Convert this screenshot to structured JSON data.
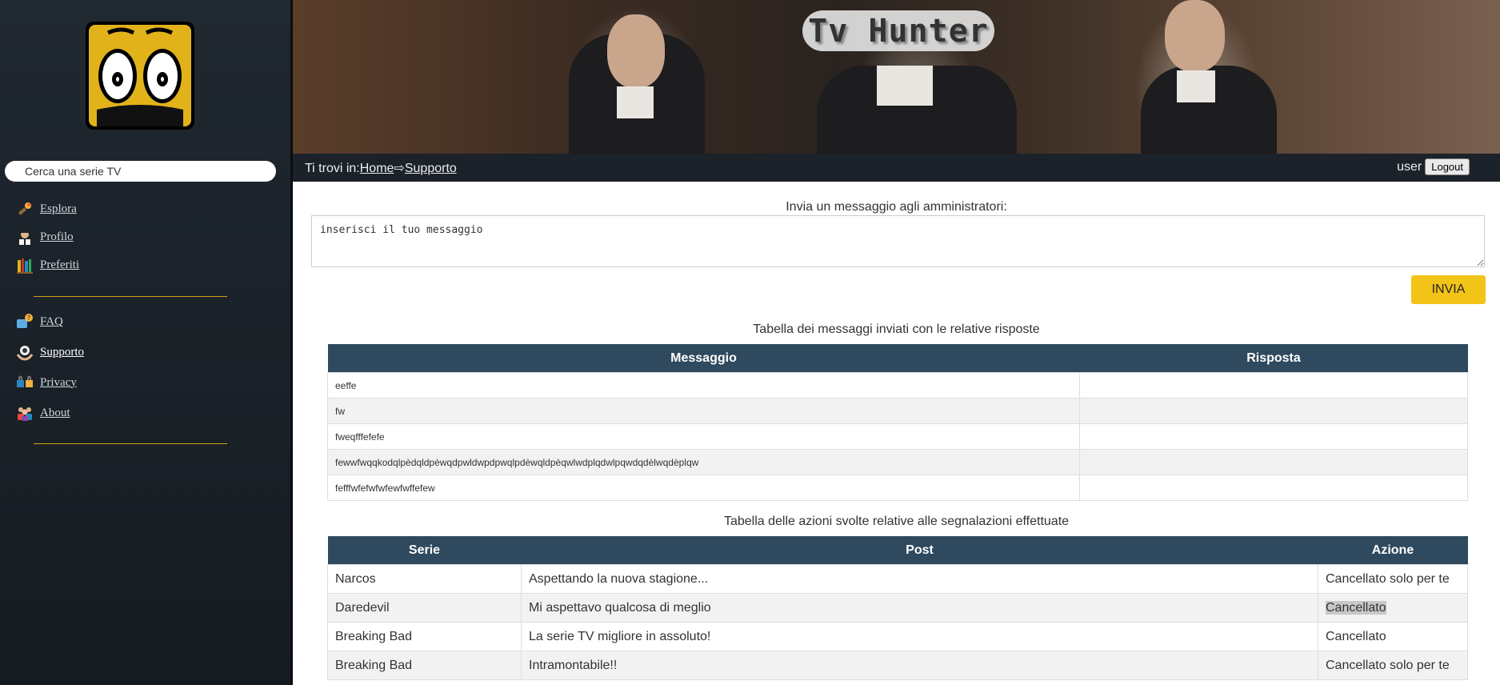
{
  "sidebar": {
    "search_placeholder": "Cerca una serie TV",
    "nav_primary": [
      {
        "label": "Esplora",
        "icon": "torch-icon"
      },
      {
        "label": "Profilo",
        "icon": "profile-icon"
      },
      {
        "label": "Preferiti",
        "icon": "books-icon"
      }
    ],
    "nav_secondary": [
      {
        "label": "FAQ",
        "icon": "faq-icon"
      },
      {
        "label": "Supporto",
        "icon": "support-icon"
      },
      {
        "label": "Privacy",
        "icon": "lock-icon"
      },
      {
        "label": "About",
        "icon": "team-icon"
      }
    ]
  },
  "header": {
    "title": "Tv Hunter",
    "breadcrumb_prefix": "Ti trovi in:",
    "breadcrumb_home": "Home",
    "breadcrumb_sep": "⇨",
    "breadcrumb_current": "Supporto",
    "username": "user",
    "logout_label": "Logout"
  },
  "form": {
    "label": "Invia un messaggio agli amministratori:",
    "textarea_value": "inserisci il tuo messaggio",
    "send_label": "INVIA"
  },
  "messages_table": {
    "caption": "Tabella dei messaggi inviati con le relative risposte",
    "headers": [
      "Messaggio",
      "Risposta"
    ],
    "rows": [
      [
        "eeffe",
        ""
      ],
      [
        "fw",
        ""
      ],
      [
        "fweqfffefefe",
        ""
      ],
      [
        "fewwfwqqkodqlpèdqldpèwqdpwldwpdpwqlpdèwqldpèqwlwdplqdwlpqwdqdèlwqdèplqw",
        ""
      ],
      [
        "fefffwfefwfwfewfwffefew",
        ""
      ]
    ]
  },
  "actions_table": {
    "caption": "Tabella delle azioni svolte relative alle segnalazioni effettuate",
    "headers": [
      "Serie",
      "Post",
      "Azione"
    ],
    "rows": [
      [
        "Narcos",
        "Aspettando la nuova stagione...",
        "Cancellato solo per te"
      ],
      [
        "Daredevil",
        "Mi aspettavo qualcosa di meglio",
        "Cancellato"
      ],
      [
        "Breaking Bad",
        "La serie TV migliore in assoluto!",
        "Cancellato"
      ],
      [
        "Breaking Bad",
        "Intramontabile!!",
        "Cancellato solo per te"
      ]
    ]
  },
  "colors": {
    "accent": "#f2c417",
    "table_header": "#2f4a5e",
    "sidebar_bg": "#1b2229",
    "divider": "#d4a11b"
  }
}
